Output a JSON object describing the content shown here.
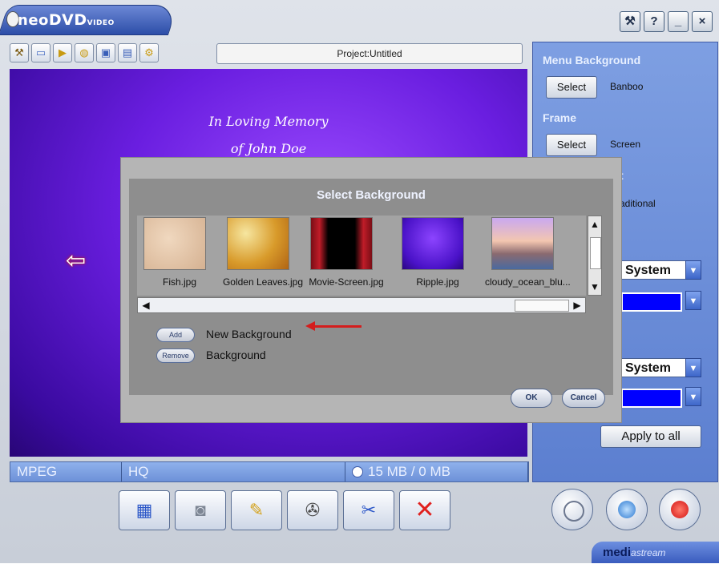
{
  "app": {
    "logo_main": "neo",
    "logo_dvd": "DVD",
    "logo_video": "VIDEO",
    "project_title": "Project:Untitled"
  },
  "window_buttons": [
    {
      "icon": "tools-icon",
      "glyph": "⚒"
    },
    {
      "icon": "help-icon",
      "glyph": "?"
    },
    {
      "icon": "minimize-icon",
      "glyph": "_"
    },
    {
      "icon": "close-icon",
      "glyph": "×"
    }
  ],
  "toolbar_icons": [
    "tools-icon",
    "new-file-icon",
    "open-folder-icon",
    "globe-icon",
    "save-icon",
    "save-as-icon",
    "settings-icon"
  ],
  "preview": {
    "line1": "In Loving Memory",
    "line2": "of John Doe"
  },
  "status": {
    "format": "MPEG",
    "quality": "HQ",
    "size": "15 MB / 0 MB"
  },
  "right_panel": {
    "menu_background_title": "Menu Background",
    "select_label": "Select",
    "menu_background_value": "Banboo",
    "frame_title": "Frame",
    "frame_value": "Screen",
    "partial_title": "t",
    "partial_value": "aditional",
    "font1": "System",
    "font2": "System",
    "color_hex": "#0000ff",
    "apply_all": "Apply to all"
  },
  "dialog": {
    "title": "Select Background",
    "thumbnails": [
      {
        "label": "Fish.jpg"
      },
      {
        "label": "Golden Leaves.jpg"
      },
      {
        "label": "Movie-Screen.jpg"
      },
      {
        "label": "Ripple.jpg"
      },
      {
        "label": "cloudy_ocean_blu..."
      }
    ],
    "add_label": "Add",
    "add_text": "New Background",
    "remove_label": "Remove",
    "remove_text": "Background",
    "ok": "OK",
    "cancel": "Cancel"
  },
  "bottom_buttons": [
    "menu-grid-icon",
    "disc-icon",
    "edit-icon",
    "film-reel-icon",
    "video-edit-icon",
    "delete-icon"
  ],
  "brand": {
    "bold": "medi",
    "light": "astream"
  }
}
